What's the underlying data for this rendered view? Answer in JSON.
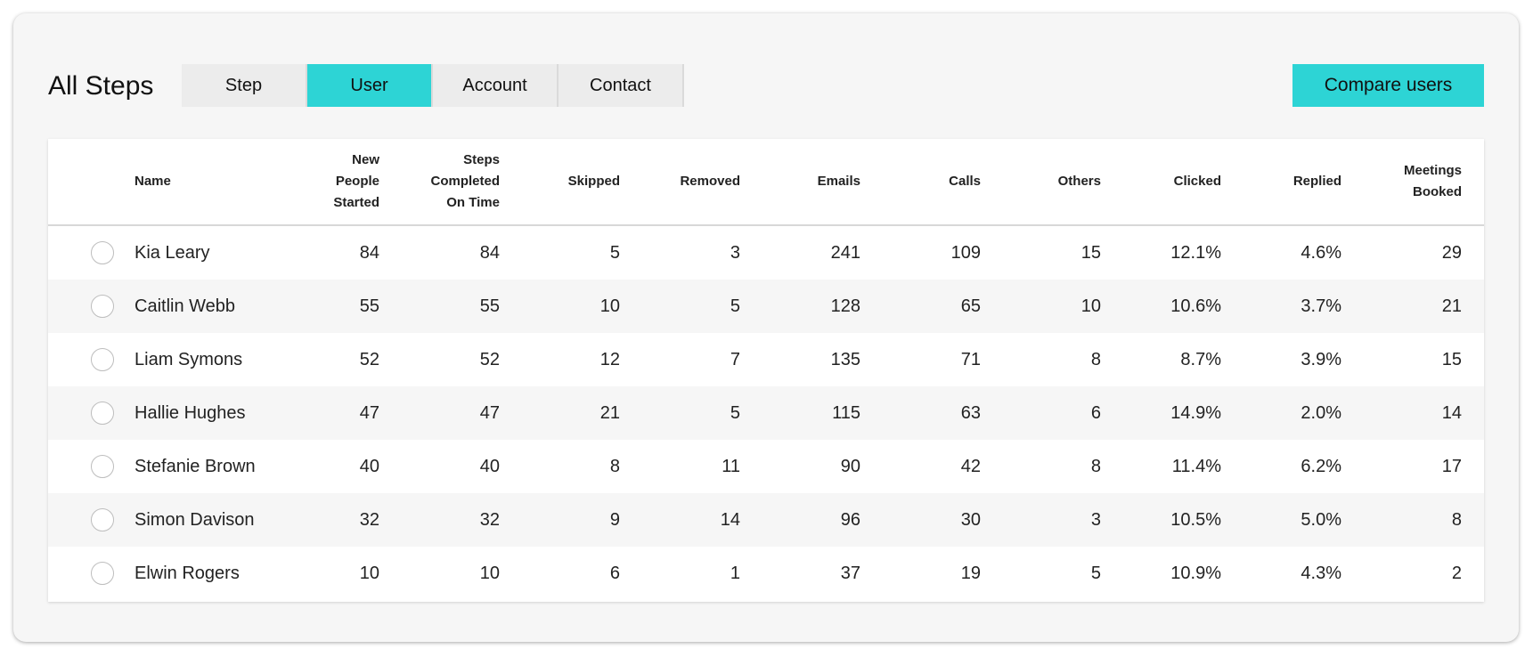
{
  "header": {
    "title": "All Steps",
    "tabs": [
      {
        "label": "Step",
        "active": false
      },
      {
        "label": "User",
        "active": true
      },
      {
        "label": "Account",
        "active": false
      },
      {
        "label": "Contact",
        "active": false
      }
    ],
    "compare_label": "Compare users"
  },
  "colors": {
    "accent": "#2dd4d5",
    "card_bg": "#f6f6f6",
    "tab_bg": "#ececec"
  },
  "table": {
    "columns": [
      "Name",
      "New\nPeople\nStarted",
      "Steps\nCompleted\nOn Time",
      "Skipped",
      "Removed",
      "Emails",
      "Calls",
      "Others",
      "Clicked",
      "Replied",
      "Meetings\nBooked"
    ],
    "rows": [
      [
        "Kia Leary",
        "84",
        "84",
        "5",
        "3",
        "241",
        "109",
        "15",
        "12.1%",
        "4.6%",
        "29"
      ],
      [
        "Caitlin Webb",
        "55",
        "55",
        "10",
        "5",
        "128",
        "65",
        "10",
        "10.6%",
        "3.7%",
        "21"
      ],
      [
        "Liam Symons",
        "52",
        "52",
        "12",
        "7",
        "135",
        "71",
        "8",
        "8.7%",
        "3.9%",
        "15"
      ],
      [
        "Hallie Hughes",
        "47",
        "47",
        "21",
        "5",
        "115",
        "63",
        "6",
        "14.9%",
        "2.0%",
        "14"
      ],
      [
        "Stefanie Brown",
        "40",
        "40",
        "8",
        "11",
        "90",
        "42",
        "8",
        "11.4%",
        "6.2%",
        "17"
      ],
      [
        "Simon Davison",
        "32",
        "32",
        "9",
        "14",
        "96",
        "30",
        "3",
        "10.5%",
        "5.0%",
        "8"
      ],
      [
        "Elwin Rogers",
        "10",
        "10",
        "6",
        "1",
        "37",
        "19",
        "5",
        "10.9%",
        "4.3%",
        "2"
      ]
    ]
  }
}
